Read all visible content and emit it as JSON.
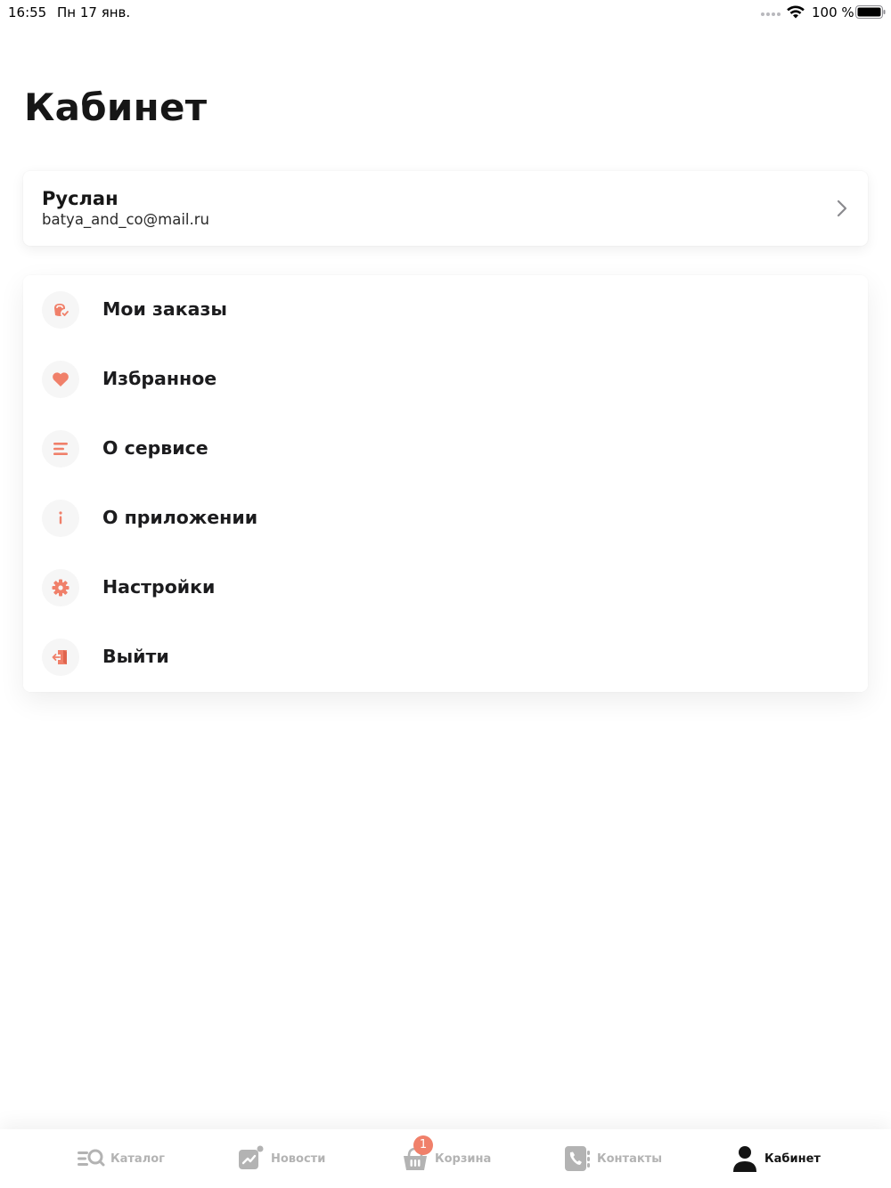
{
  "status_bar": {
    "time": "16:55",
    "date": "Пн 17 янв.",
    "battery": "100 %"
  },
  "title": "Кабинет",
  "profile": {
    "name": "Руслан",
    "email": "batya_and_co@mail.ru"
  },
  "menu": {
    "items": [
      {
        "label": "Мои заказы",
        "icon": "orders-icon"
      },
      {
        "label": "Избранное",
        "icon": "heart-icon"
      },
      {
        "label": "О сервисе",
        "icon": "lines-icon"
      },
      {
        "label": "О приложении",
        "icon": "info-icon"
      },
      {
        "label": "Настройки",
        "icon": "gear-icon"
      },
      {
        "label": "Выйти",
        "icon": "logout-icon"
      }
    ]
  },
  "tabs": [
    {
      "label": "Каталог",
      "icon": "catalog-search-icon",
      "active": false
    },
    {
      "label": "Новости",
      "icon": "news-icon",
      "active": false
    },
    {
      "label": "Корзина",
      "icon": "basket-icon",
      "active": false,
      "badge": "1"
    },
    {
      "label": "Контакты",
      "icon": "phone-book-icon",
      "active": false
    },
    {
      "label": "Кабинет",
      "icon": "person-icon",
      "active": true
    }
  ],
  "colors": {
    "accent": "#f0806a",
    "icon_circle": "#f6f6f6",
    "tab_inactive": "#b3b3b3",
    "tab_active": "#141414"
  }
}
